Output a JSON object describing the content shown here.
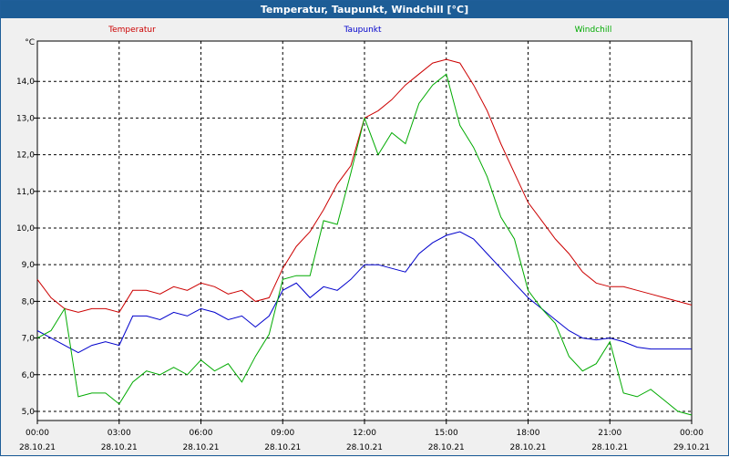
{
  "window": {
    "title": "Temperatur, Taupunkt, Windchill [°C]"
  },
  "chart_data": {
    "type": "line",
    "title": "Temperatur, Taupunkt, Windchill [°C]",
    "ylabel": "°C",
    "ylim": [
      4.75,
      15.1
    ],
    "xlim": [
      0,
      24
    ],
    "grid": true,
    "legend_position": "top",
    "y_ticks": [
      "5,0",
      "6,0",
      "7,0",
      "8,0",
      "9,0",
      "10,0",
      "11,0",
      "12,0",
      "13,0",
      "14,0"
    ],
    "y_tick_values": [
      5,
      6,
      7,
      8,
      9,
      10,
      11,
      12,
      13,
      14
    ],
    "x_ticks": [
      {
        "time": "00:00",
        "date": "28.10.21"
      },
      {
        "time": "03:00",
        "date": "28.10.21"
      },
      {
        "time": "06:00",
        "date": "28.10.21"
      },
      {
        "time": "09:00",
        "date": "28.10.21"
      },
      {
        "time": "12:00",
        "date": "28.10.21"
      },
      {
        "time": "15:00",
        "date": "28.10.21"
      },
      {
        "time": "18:00",
        "date": "28.10.21"
      },
      {
        "time": "21:00",
        "date": "28.10.21"
      },
      {
        "time": "00:00",
        "date": "29.10.21"
      }
    ],
    "x_tick_values": [
      0,
      3,
      6,
      9,
      12,
      15,
      18,
      21,
      24
    ],
    "series": [
      {
        "name": "Temperatur",
        "color": "#cc0000",
        "x": [
          0,
          0.5,
          1,
          1.5,
          2,
          2.5,
          3,
          3.5,
          4,
          4.5,
          5,
          5.5,
          6,
          6.5,
          7,
          7.5,
          8,
          8.5,
          9,
          9.5,
          10,
          10.5,
          11,
          11.5,
          12,
          12.5,
          13,
          13.5,
          14,
          14.5,
          15,
          15.5,
          16,
          16.5,
          17,
          17.5,
          18,
          18.5,
          19,
          19.5,
          20,
          20.5,
          21,
          21.5,
          22,
          22.5,
          23,
          23.5,
          24
        ],
        "values": [
          8.6,
          8.1,
          7.8,
          7.7,
          7.8,
          7.8,
          7.7,
          8.3,
          8.3,
          8.2,
          8.4,
          8.3,
          8.5,
          8.4,
          8.2,
          8.3,
          8.0,
          8.1,
          8.9,
          9.5,
          9.9,
          10.5,
          11.2,
          11.7,
          13.0,
          13.2,
          13.5,
          13.9,
          14.2,
          14.5,
          14.6,
          14.5,
          13.9,
          13.2,
          12.3,
          11.5,
          10.7,
          10.2,
          9.7,
          9.3,
          8.8,
          8.5,
          8.4,
          8.4,
          8.3,
          8.2,
          8.1,
          8.0,
          7.9
        ]
      },
      {
        "name": "Taupunkt",
        "color": "#0000cc",
        "x": [
          0,
          0.5,
          1,
          1.5,
          2,
          2.5,
          3,
          3.5,
          4,
          4.5,
          5,
          5.5,
          6,
          6.5,
          7,
          7.5,
          8,
          8.5,
          9,
          9.5,
          10,
          10.5,
          11,
          11.5,
          12,
          12.5,
          13,
          13.5,
          14,
          14.5,
          15,
          15.5,
          16,
          16.5,
          17,
          17.5,
          18,
          18.5,
          19,
          19.5,
          20,
          20.5,
          21,
          21.5,
          22,
          22.5,
          23,
          23.5,
          24
        ],
        "values": [
          7.2,
          7.0,
          6.8,
          6.6,
          6.8,
          6.9,
          6.8,
          7.6,
          7.6,
          7.5,
          7.7,
          7.6,
          7.8,
          7.7,
          7.5,
          7.6,
          7.3,
          7.6,
          8.3,
          8.5,
          8.1,
          8.4,
          8.3,
          8.6,
          9.0,
          9.0,
          8.9,
          8.8,
          9.3,
          9.6,
          9.8,
          9.9,
          9.7,
          9.3,
          8.9,
          8.5,
          8.1,
          7.8,
          7.5,
          7.2,
          7.0,
          6.95,
          7.0,
          6.9,
          6.75,
          6.7,
          6.7,
          6.7,
          6.7
        ]
      },
      {
        "name": "Windchill",
        "color": "#00aa00",
        "x": [
          0,
          0.5,
          1,
          1.5,
          2,
          2.5,
          3,
          3.5,
          4,
          4.5,
          5,
          5.5,
          6,
          6.5,
          7,
          7.5,
          8,
          8.5,
          9,
          9.5,
          10,
          10.5,
          11,
          11.5,
          12,
          12.5,
          13,
          13.5,
          14,
          14.5,
          15,
          15.5,
          16,
          16.5,
          17,
          17.5,
          18,
          18.5,
          19,
          19.5,
          20,
          20.5,
          21,
          21.5,
          22,
          22.5,
          23,
          23.5,
          24
        ],
        "values": [
          7.0,
          7.2,
          7.8,
          5.4,
          5.5,
          5.5,
          5.2,
          5.8,
          6.1,
          6.0,
          6.2,
          6.0,
          6.4,
          6.1,
          6.3,
          5.8,
          6.5,
          7.1,
          8.6,
          8.7,
          8.7,
          10.2,
          10.1,
          11.5,
          13.0,
          12.0,
          12.6,
          12.3,
          13.4,
          13.9,
          14.2,
          12.8,
          12.2,
          11.4,
          10.3,
          9.7,
          8.3,
          7.8,
          7.4,
          6.5,
          6.1,
          6.3,
          6.9,
          5.5,
          5.4,
          5.6,
          5.3,
          5.0,
          4.9
        ]
      }
    ]
  }
}
